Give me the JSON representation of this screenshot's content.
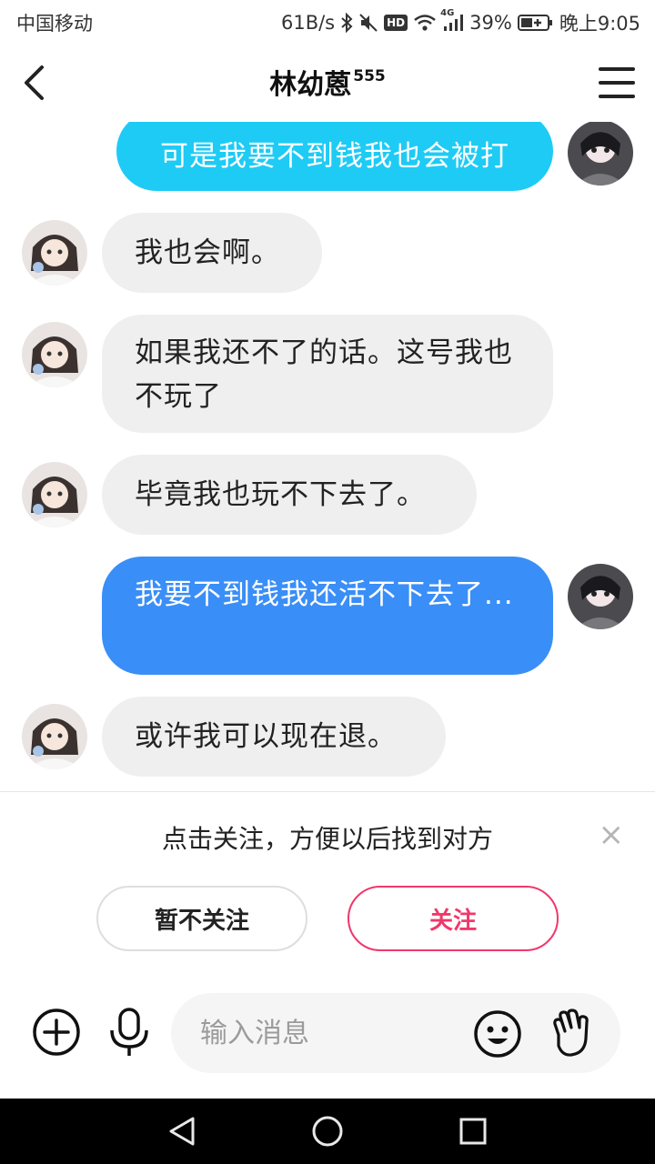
{
  "status_bar": {
    "carrier": "中国移动",
    "net_speed": "61B/s",
    "hd_badge": "HD",
    "network_type": "4G",
    "battery": "39%",
    "time": "晚上9:05"
  },
  "header": {
    "title": "林幼蒽",
    "title_suffix": "555"
  },
  "messages": [
    {
      "side": "out",
      "text": "可是我要不到钱我也会被打",
      "color": "#1ecbf5"
    },
    {
      "side": "in",
      "text": "我也会啊。"
    },
    {
      "side": "in",
      "text": "如果我还不了的话。这号我也不玩了"
    },
    {
      "side": "in",
      "text": "毕竟我也玩不下去了。"
    },
    {
      "side": "out",
      "text": "我要不到钱我还活不下去了...",
      "color": "#3a8ef7"
    },
    {
      "side": "in",
      "text": "或许我可以现在退。"
    }
  ],
  "follow_prompt": {
    "text": "点击关注，方便以后找到对方",
    "close_symbol": "×",
    "decline_label": "暂不关注",
    "follow_label": "关注",
    "follow_color": "#f0386b"
  },
  "input": {
    "placeholder": "输入消息"
  },
  "icons": [
    "back-icon",
    "menu-icon",
    "plus-icon",
    "microphone-icon",
    "emoji-icon",
    "wave-hand-icon",
    "nav-back-icon",
    "nav-home-icon",
    "nav-recents-icon"
  ]
}
